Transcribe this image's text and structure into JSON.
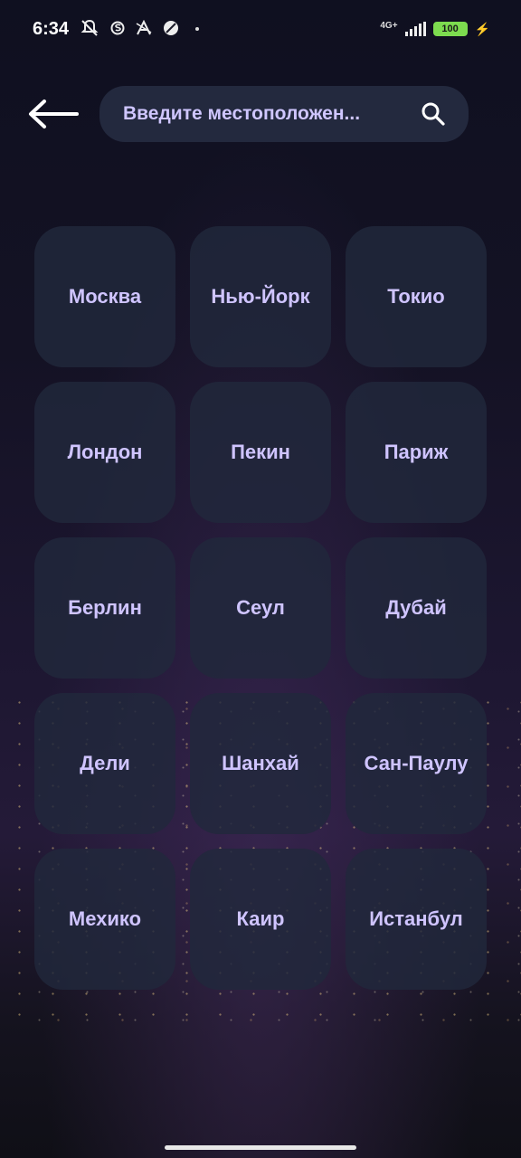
{
  "status_bar": {
    "time": "6:34",
    "network": "4G+",
    "battery": "100",
    "icons": [
      "notifications-off-icon",
      "s-app-icon",
      "a-app-icon",
      "no-entry-icon",
      "dot-icon",
      "signal-icon",
      "battery-icon",
      "charging-icon"
    ]
  },
  "header": {
    "back_icon": "arrow-left-icon",
    "search": {
      "placeholder": "Введите местоположен...",
      "value": "",
      "icon": "search-icon"
    }
  },
  "cities": [
    {
      "label": "Москва"
    },
    {
      "label": "Нью-Йорк"
    },
    {
      "label": "Токио"
    },
    {
      "label": "Лондон"
    },
    {
      "label": "Пекин"
    },
    {
      "label": "Париж"
    },
    {
      "label": "Берлин"
    },
    {
      "label": "Сеул"
    },
    {
      "label": "Дубай"
    },
    {
      "label": "Дели"
    },
    {
      "label": "Шанхай"
    },
    {
      "label": "Сан-Паулу"
    },
    {
      "label": "Мехико"
    },
    {
      "label": "Каир"
    },
    {
      "label": "Истанбул"
    }
  ],
  "colors": {
    "tile_bg": "#21283c",
    "label": "#cfc4ff",
    "battery": "#7ddc4f"
  }
}
